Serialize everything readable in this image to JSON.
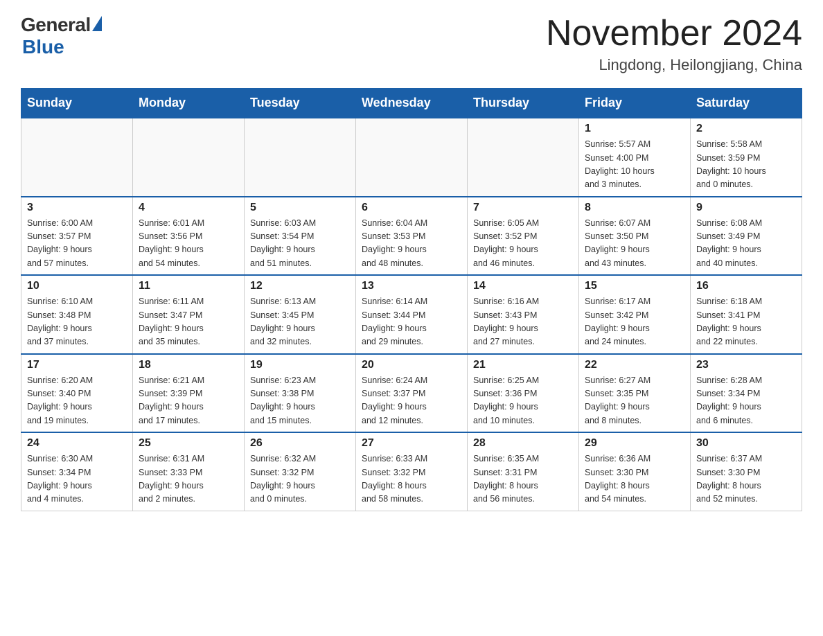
{
  "header": {
    "logo_general": "General",
    "logo_blue": "Blue",
    "month_title": "November 2024",
    "location": "Lingdong, Heilongjiang, China"
  },
  "weekdays": [
    "Sunday",
    "Monday",
    "Tuesday",
    "Wednesday",
    "Thursday",
    "Friday",
    "Saturday"
  ],
  "weeks": [
    [
      {
        "day": "",
        "info": ""
      },
      {
        "day": "",
        "info": ""
      },
      {
        "day": "",
        "info": ""
      },
      {
        "day": "",
        "info": ""
      },
      {
        "day": "",
        "info": ""
      },
      {
        "day": "1",
        "info": "Sunrise: 5:57 AM\nSunset: 4:00 PM\nDaylight: 10 hours\nand 3 minutes."
      },
      {
        "day": "2",
        "info": "Sunrise: 5:58 AM\nSunset: 3:59 PM\nDaylight: 10 hours\nand 0 minutes."
      }
    ],
    [
      {
        "day": "3",
        "info": "Sunrise: 6:00 AM\nSunset: 3:57 PM\nDaylight: 9 hours\nand 57 minutes."
      },
      {
        "day": "4",
        "info": "Sunrise: 6:01 AM\nSunset: 3:56 PM\nDaylight: 9 hours\nand 54 minutes."
      },
      {
        "day": "5",
        "info": "Sunrise: 6:03 AM\nSunset: 3:54 PM\nDaylight: 9 hours\nand 51 minutes."
      },
      {
        "day": "6",
        "info": "Sunrise: 6:04 AM\nSunset: 3:53 PM\nDaylight: 9 hours\nand 48 minutes."
      },
      {
        "day": "7",
        "info": "Sunrise: 6:05 AM\nSunset: 3:52 PM\nDaylight: 9 hours\nand 46 minutes."
      },
      {
        "day": "8",
        "info": "Sunrise: 6:07 AM\nSunset: 3:50 PM\nDaylight: 9 hours\nand 43 minutes."
      },
      {
        "day": "9",
        "info": "Sunrise: 6:08 AM\nSunset: 3:49 PM\nDaylight: 9 hours\nand 40 minutes."
      }
    ],
    [
      {
        "day": "10",
        "info": "Sunrise: 6:10 AM\nSunset: 3:48 PM\nDaylight: 9 hours\nand 37 minutes."
      },
      {
        "day": "11",
        "info": "Sunrise: 6:11 AM\nSunset: 3:47 PM\nDaylight: 9 hours\nand 35 minutes."
      },
      {
        "day": "12",
        "info": "Sunrise: 6:13 AM\nSunset: 3:45 PM\nDaylight: 9 hours\nand 32 minutes."
      },
      {
        "day": "13",
        "info": "Sunrise: 6:14 AM\nSunset: 3:44 PM\nDaylight: 9 hours\nand 29 minutes."
      },
      {
        "day": "14",
        "info": "Sunrise: 6:16 AM\nSunset: 3:43 PM\nDaylight: 9 hours\nand 27 minutes."
      },
      {
        "day": "15",
        "info": "Sunrise: 6:17 AM\nSunset: 3:42 PM\nDaylight: 9 hours\nand 24 minutes."
      },
      {
        "day": "16",
        "info": "Sunrise: 6:18 AM\nSunset: 3:41 PM\nDaylight: 9 hours\nand 22 minutes."
      }
    ],
    [
      {
        "day": "17",
        "info": "Sunrise: 6:20 AM\nSunset: 3:40 PM\nDaylight: 9 hours\nand 19 minutes."
      },
      {
        "day": "18",
        "info": "Sunrise: 6:21 AM\nSunset: 3:39 PM\nDaylight: 9 hours\nand 17 minutes."
      },
      {
        "day": "19",
        "info": "Sunrise: 6:23 AM\nSunset: 3:38 PM\nDaylight: 9 hours\nand 15 minutes."
      },
      {
        "day": "20",
        "info": "Sunrise: 6:24 AM\nSunset: 3:37 PM\nDaylight: 9 hours\nand 12 minutes."
      },
      {
        "day": "21",
        "info": "Sunrise: 6:25 AM\nSunset: 3:36 PM\nDaylight: 9 hours\nand 10 minutes."
      },
      {
        "day": "22",
        "info": "Sunrise: 6:27 AM\nSunset: 3:35 PM\nDaylight: 9 hours\nand 8 minutes."
      },
      {
        "day": "23",
        "info": "Sunrise: 6:28 AM\nSunset: 3:34 PM\nDaylight: 9 hours\nand 6 minutes."
      }
    ],
    [
      {
        "day": "24",
        "info": "Sunrise: 6:30 AM\nSunset: 3:34 PM\nDaylight: 9 hours\nand 4 minutes."
      },
      {
        "day": "25",
        "info": "Sunrise: 6:31 AM\nSunset: 3:33 PM\nDaylight: 9 hours\nand 2 minutes."
      },
      {
        "day": "26",
        "info": "Sunrise: 6:32 AM\nSunset: 3:32 PM\nDaylight: 9 hours\nand 0 minutes."
      },
      {
        "day": "27",
        "info": "Sunrise: 6:33 AM\nSunset: 3:32 PM\nDaylight: 8 hours\nand 58 minutes."
      },
      {
        "day": "28",
        "info": "Sunrise: 6:35 AM\nSunset: 3:31 PM\nDaylight: 8 hours\nand 56 minutes."
      },
      {
        "day": "29",
        "info": "Sunrise: 6:36 AM\nSunset: 3:30 PM\nDaylight: 8 hours\nand 54 minutes."
      },
      {
        "day": "30",
        "info": "Sunrise: 6:37 AM\nSunset: 3:30 PM\nDaylight: 8 hours\nand 52 minutes."
      }
    ]
  ]
}
